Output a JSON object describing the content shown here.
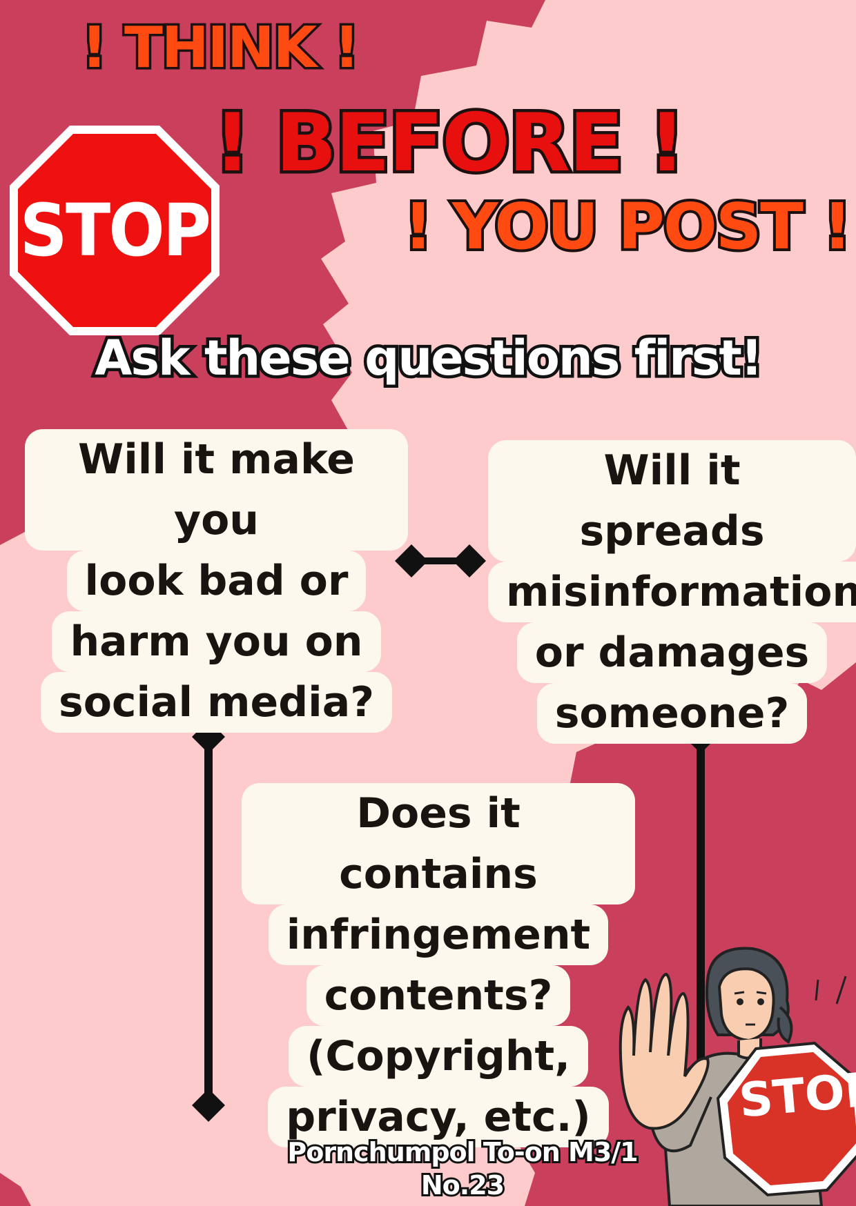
{
  "header": {
    "line1": "! THINK !",
    "line2": "! BEFORE !",
    "line3": "! YOU POST !"
  },
  "stop_sign_label": "STOP",
  "subtitle": "Ask these questions first!",
  "questions": [
    {
      "lines": [
        "Will it make you",
        "look bad or",
        "harm you on",
        "social media?"
      ]
    },
    {
      "lines": [
        "Will it spreads",
        "misinformation",
        "or damages",
        "someone?"
      ]
    },
    {
      "lines": [
        "Does it contains",
        "infringement",
        "contents?",
        "(Copyright,",
        "privacy, etc.)"
      ]
    }
  ],
  "illustration": {
    "stop_sign_label": "STOP"
  },
  "credit": {
    "line1": "Pornchumpol To-on M3/1",
    "line2": "No.23"
  },
  "colors": {
    "background_light": "#fdcbcb",
    "background_dark": "#c93f5c",
    "stop_red": "#ef1010",
    "title_orange": "#ff4b12",
    "title_red": "#e8100e",
    "box_cream": "#fdf8ee"
  }
}
